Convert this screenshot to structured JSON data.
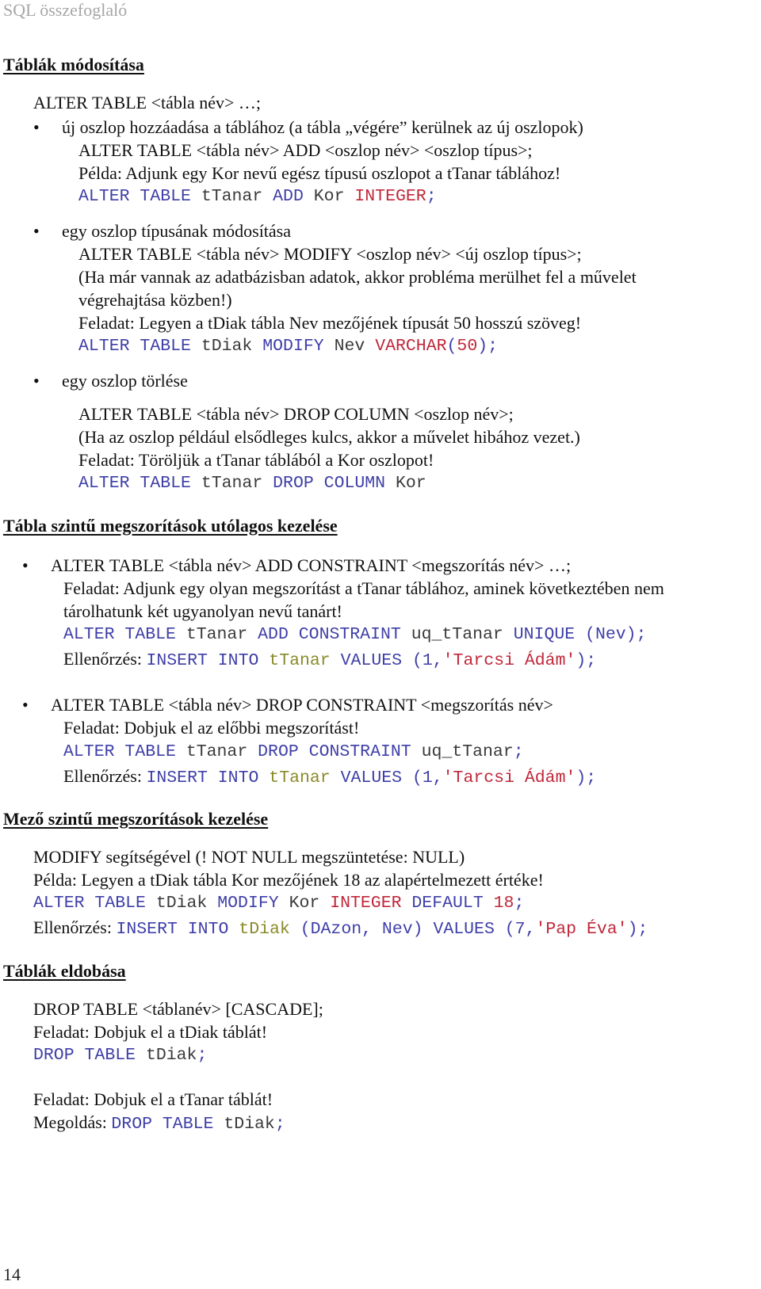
{
  "header": {
    "title": "SQL összefoglaló"
  },
  "sections": {
    "modify_tables": {
      "heading": "Táblák módosítása",
      "intro": "ALTER TABLE <tábla név> …;",
      "add_column": {
        "bullet": "új oszlop hozzáadása a táblához (a tábla „végére” kerülnek az új oszlopok)",
        "syntax": "ALTER TABLE <tábla név> ADD <oszlop név> <oszlop típus>;",
        "example": "Példa: Adjunk egy Kor nevű egész típusú oszlopot a tTanar táblához!",
        "code": [
          [
            "kw",
            "ALTER TABLE "
          ],
          [
            "id",
            "tTanar "
          ],
          [
            "kw",
            "ADD "
          ],
          [
            "id",
            "Kor "
          ],
          [
            "ty",
            "INTEGER"
          ],
          [
            "kw",
            ";"
          ]
        ]
      },
      "modify_column": {
        "bullet": "egy oszlop típusának módosítása",
        "syntax": "ALTER TABLE <tábla név> MODIFY <oszlop név> <új oszlop típus>;",
        "note_line1": "(Ha már vannak az adatbázisban adatok, akkor probléma merülhet fel a művelet",
        "note_line2": "végrehajtása közben!)",
        "task": "Feladat: Legyen a tDiak tábla Nev mezőjének típusát 50 hosszú szöveg!",
        "code": [
          [
            "kw",
            "ALTER TABLE "
          ],
          [
            "id",
            "tDiak "
          ],
          [
            "kw",
            "MODIFY "
          ],
          [
            "id",
            "Nev "
          ],
          [
            "ty",
            "VARCHAR"
          ],
          [
            "kw",
            "("
          ],
          [
            "ty",
            "50"
          ],
          [
            "kw",
            ");"
          ]
        ]
      },
      "drop_column": {
        "bullet": "egy oszlop törlése",
        "syntax": "ALTER TABLE <tábla név> DROP COLUMN <oszlop név>;",
        "note": "(Ha az oszlop például elsődleges kulcs, akkor a művelet hibához vezet.)",
        "task": "Feladat: Töröljük a tTanar táblából a Kor oszlopot!",
        "code": [
          [
            "kw",
            "ALTER TABLE "
          ],
          [
            "id",
            "tTanar "
          ],
          [
            "kw",
            "DROP COLUMN "
          ],
          [
            "id",
            "Kor"
          ]
        ]
      }
    },
    "table_constraints": {
      "heading": "Tábla szintű megszorítások utólagos kezelése",
      "add": {
        "bullet": "ALTER TABLE <tábla név> ADD CONSTRAINT <megszorítás név> …;",
        "task_line1": "Feladat: Adjunk egy olyan megszorítást a tTanar táblához, aminek következtében nem",
        "task_line2": "tárolhatunk két ugyanolyan nevű tanárt!",
        "code": [
          [
            "kw",
            "ALTER TABLE "
          ],
          [
            "id",
            "tTanar "
          ],
          [
            "kw",
            "ADD CONSTRAINT "
          ],
          [
            "id",
            "uq_tTanar "
          ],
          [
            "kw",
            "UNIQUE (Nev);"
          ]
        ],
        "check_label": "Ellenőrzés: ",
        "check_code": [
          [
            "kw",
            "INSERT INTO "
          ],
          [
            "tb",
            "tTanar "
          ],
          [
            "kw",
            "VALUES (1,"
          ],
          [
            "ty",
            "'Tarcsi Ádám'"
          ],
          [
            "kw",
            ");"
          ]
        ]
      },
      "drop": {
        "bullet": "ALTER TABLE <tábla név> DROP CONSTRAINT <megszorítás név>",
        "task": "Feladat: Dobjuk el az előbbi megszorítást!",
        "code": [
          [
            "kw",
            "ALTER TABLE "
          ],
          [
            "id",
            "tTanar "
          ],
          [
            "kw",
            "DROP CONSTRAINT "
          ],
          [
            "id",
            "uq_tTanar"
          ],
          [
            "kw",
            ";"
          ]
        ],
        "check_label": "Ellenőrzés: ",
        "check_code": [
          [
            "kw",
            "INSERT INTO "
          ],
          [
            "tb",
            "tTanar "
          ],
          [
            "kw",
            "VALUES (1,"
          ],
          [
            "ty",
            "'Tarcsi Ádám'"
          ],
          [
            "kw",
            ");"
          ]
        ]
      }
    },
    "field_constraints": {
      "heading": "Mező szintű megszorítások kezelése",
      "line1": "MODIFY segítségével (! NOT NULL megszüntetése: NULL)",
      "example": "Példa: Legyen a tDiak tábla Kor mezőjének 18 az alapértelmezett értéke!",
      "code": [
        [
          "kw",
          "ALTER TABLE "
        ],
        [
          "id",
          "tDiak "
        ],
        [
          "kw",
          "MODIFY "
        ],
        [
          "id",
          "Kor "
        ],
        [
          "ty",
          "INTEGER "
        ],
        [
          "kw",
          "DEFAULT "
        ],
        [
          "ty",
          "18"
        ],
        [
          "kw",
          ";"
        ]
      ],
      "check_label": "Ellenőrzés: ",
      "check_code": [
        [
          "kw",
          "INSERT INTO "
        ],
        [
          "tb",
          "tDiak "
        ],
        [
          "kw",
          "(DAzon, Nev) VALUES (7,"
        ],
        [
          "ty",
          "'Pap Éva'"
        ],
        [
          "kw",
          ");"
        ]
      ]
    },
    "drop_tables": {
      "heading": "Táblák eldobása",
      "syntax": "DROP TABLE <táblanév> [CASCADE];",
      "task1": "Feladat: Dobjuk el a tDiak táblát!",
      "code1": [
        [
          "kw",
          "DROP TABLE "
        ],
        [
          "id",
          "tDiak"
        ],
        [
          "kw",
          ";"
        ]
      ],
      "task2": "Feladat: Dobjuk el a tTanar táblát!",
      "solution_label": "Megoldás: ",
      "code2": [
        [
          "kw",
          "DROP TABLE "
        ],
        [
          "id",
          "tDiak"
        ],
        [
          "kw",
          ";"
        ]
      ]
    }
  },
  "footer": {
    "page_number": "14"
  },
  "colors": {
    "keyword": "#3f3fa8",
    "identifier": "#3a3a3a",
    "literal": "#c0283a",
    "table_ref": "#8a8a2a",
    "header": "#a6a6a6"
  }
}
